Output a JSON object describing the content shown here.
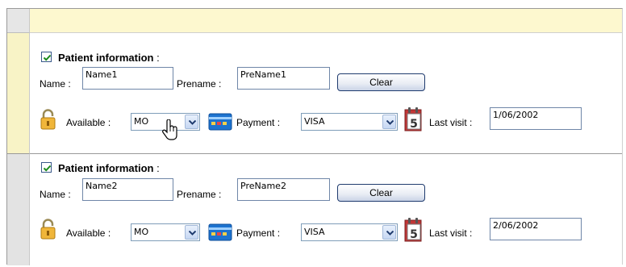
{
  "rows": [
    {
      "title": "Patient information",
      "title_colon": ":",
      "checked": true,
      "name_label": "Name :",
      "name_value": "Name1",
      "prename_label": "Prename :",
      "prename_value": "PreName1",
      "clear_label": "Clear",
      "available_label": "Available :",
      "available_value": "MO",
      "payment_label": "Payment :",
      "payment_value": "VISA",
      "calendar_day": "5",
      "last_visit_label": "Last visit :",
      "last_visit_value": "1/06/2002"
    },
    {
      "title": "Patient information",
      "title_colon": ":",
      "checked": true,
      "name_label": "Name :",
      "name_value": "Name2",
      "prename_label": "Prename :",
      "prename_value": "PreName2",
      "clear_label": "Clear",
      "available_label": "Available :",
      "available_value": "MO",
      "payment_label": "Payment :",
      "payment_value": "VISA",
      "calendar_day": "5",
      "last_visit_label": "Last visit :",
      "last_visit_value": "2/06/2002"
    }
  ],
  "icons": {
    "lock": "lock-icon",
    "payment": "payment-card-icon",
    "calendar": "calendar-icon",
    "cursor": "hand-pointer-icon"
  },
  "colors": {
    "header_bg": "#fdf8cf",
    "selected_row_header": "#f8f3c6",
    "row_header": "#e3e3e3",
    "input_border": "#6f86a8",
    "button_border": "#1f3b6e"
  }
}
